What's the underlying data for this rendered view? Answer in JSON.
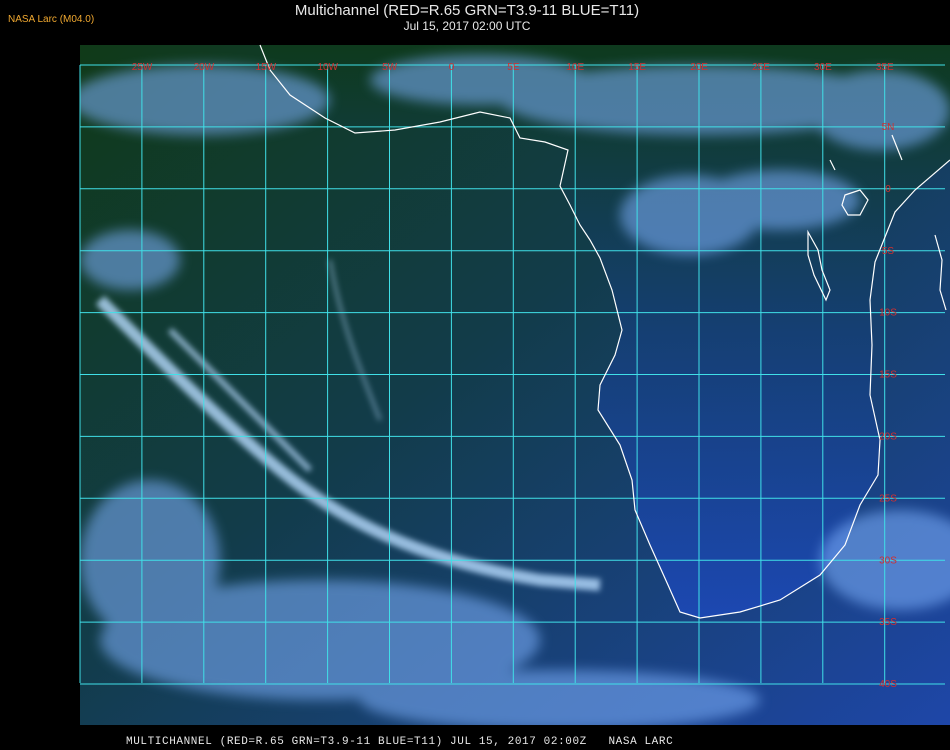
{
  "header": {
    "provider": "NASA Larc (M04.0)",
    "title": "Multichannel (RED=R.65 GRN=T3.9-11 BLUE=T11)",
    "datetime": "Jul 15, 2017 02:00 UTC"
  },
  "footer": {
    "caption": "MULTICHANNEL (RED=R.65 GRN=T3.9-11 BLUE=T11) JUL 15, 2017 02:00Z   NASA LARC"
  },
  "map": {
    "longitude_labels": [
      "25W",
      "20W",
      "15W",
      "10W",
      "5W",
      "0",
      "5E",
      "10E",
      "15E",
      "20E",
      "25E",
      "30E",
      "35E"
    ],
    "latitude_labels": [
      "5N",
      "0",
      "5S",
      "10S",
      "15S",
      "20S",
      "25S",
      "30S",
      "35S",
      "40S"
    ],
    "colors": {
      "grid": "#40e0e8",
      "coastline": "#ffffff",
      "label": "#d03030",
      "land": "#0e3a1c",
      "ocean": "#1c3f96",
      "cloud": "#9cc8ff"
    },
    "icons": [
      "coastline-africa"
    ]
  }
}
